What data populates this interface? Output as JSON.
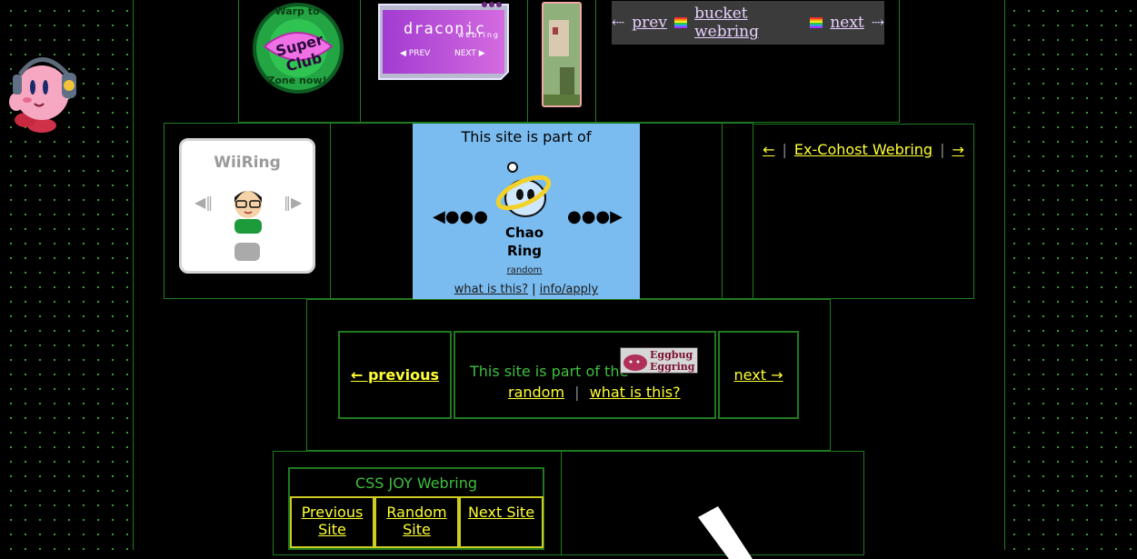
{
  "bucket_webring": {
    "prev_label": "prev",
    "title": "bucket webring",
    "next_label": "next",
    "left_arrow": "⇠",
    "right_arrow": "⇢"
  },
  "warp_badge": {
    "text_top": "Warp to",
    "text_center": "Super Club",
    "text_bottom": "Zone now!"
  },
  "draconic_badge": {
    "title": "draconic",
    "subtitle": "webring",
    "prev_label": "PREV",
    "next_label": "NEXT"
  },
  "wiiring": {
    "title": "WiiRing"
  },
  "chao_ring": {
    "intro": "This site is part of",
    "name_line1": "Chao",
    "name_line2": "Ring",
    "random_label": "random",
    "what_label": "what is this?",
    "info_label": "info/apply",
    "separator": "|"
  },
  "excohost": {
    "prev_arrow": "←",
    "name": "Ex-Cohost Webring",
    "next_arrow": "→",
    "separator": "|"
  },
  "eggbug": {
    "previous_label": "← previous",
    "intro": "This site is part of the",
    "badge_line1": "Eggbug",
    "badge_line2": "Eggring",
    "random_label": "random",
    "separator": "|",
    "what_label": "what is this?",
    "next_label": "next →"
  },
  "css_joy": {
    "title": "CSS JOY Webring",
    "previous_label": "Previous Site",
    "random_label": "Random Site",
    "next_label": "Next Site"
  }
}
